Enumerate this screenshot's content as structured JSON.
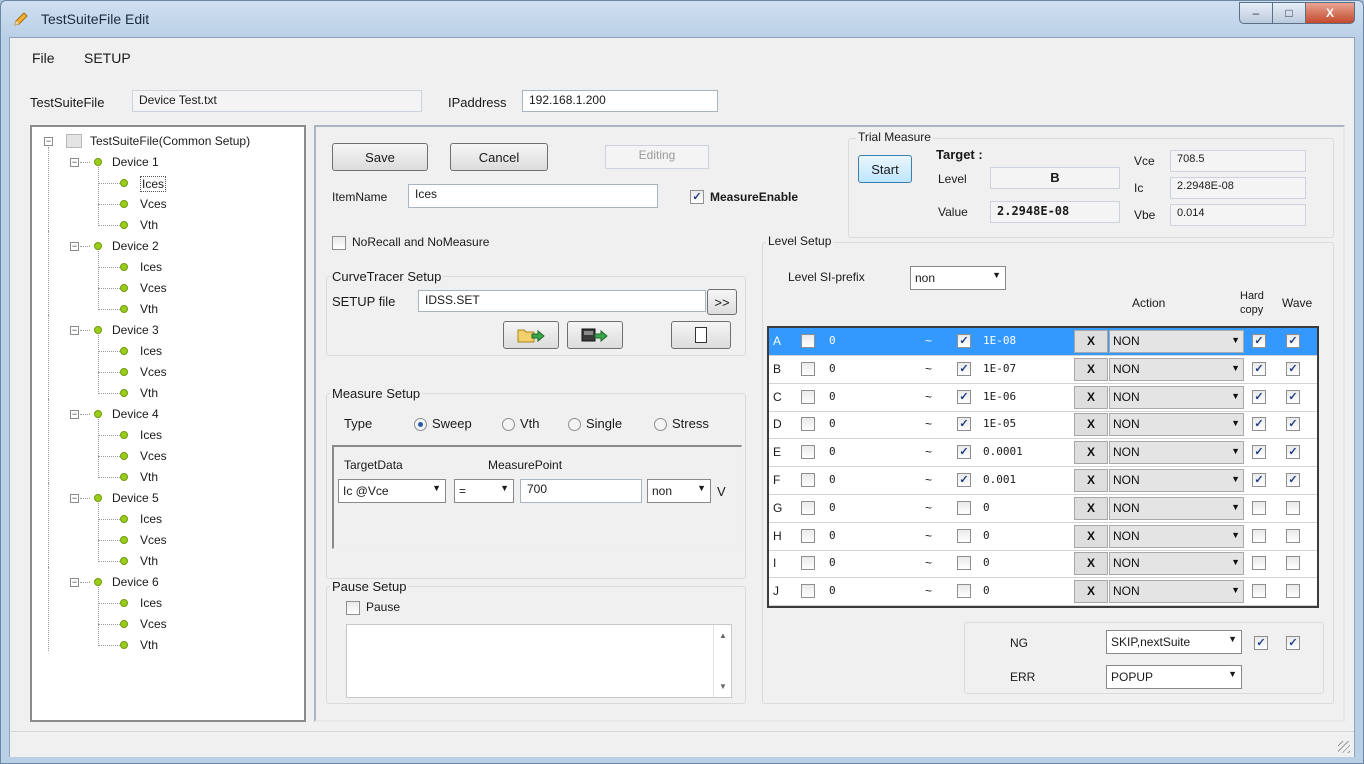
{
  "window": {
    "title": "TestSuiteFile Edit",
    "controls": {
      "min": "–",
      "max": "□",
      "close": "X"
    }
  },
  "menu": [
    "File",
    "SETUP"
  ],
  "header": {
    "file_label": "TestSuiteFile",
    "file_value": "Device Test.txt",
    "ip_label": "IPaddress",
    "ip_value": "192.168.1.200"
  },
  "tree": {
    "root": "TestSuiteFile(Common Setup)",
    "devices": [
      {
        "name": "Device 1",
        "items": [
          "Ices",
          "Vces",
          "Vth"
        ]
      },
      {
        "name": "Device 2",
        "items": [
          "Ices",
          "Vces",
          "Vth"
        ]
      },
      {
        "name": "Device 3",
        "items": [
          "Ices",
          "Vces",
          "Vth"
        ]
      },
      {
        "name": "Device 4",
        "items": [
          "Ices",
          "Vces",
          "Vth"
        ]
      },
      {
        "name": "Device 5",
        "items": [
          "Ices",
          "Vces",
          "Vth"
        ]
      },
      {
        "name": "Device 6",
        "items": [
          "Ices",
          "Vces",
          "Vth"
        ]
      }
    ]
  },
  "editor": {
    "save": "Save",
    "cancel": "Cancel",
    "status": "Editing",
    "item_name_label": "ItemName",
    "item_name_value": "Ices",
    "measure_enable": "MeasureEnable",
    "no_recall": "NoRecall and NoMeasure"
  },
  "curve_tracer": {
    "title": "CurveTracer Setup",
    "setup_file_label": "SETUP file",
    "setup_file_value": "IDSS.SET",
    "browse": ">>"
  },
  "measure_setup": {
    "title": "Measure Setup",
    "type_label": "Type",
    "types": [
      "Sweep",
      "Vth",
      "Single",
      "Stress"
    ],
    "selected_type": "Sweep",
    "target_label": "TargetData",
    "measure_point_label": "MeasurePoint",
    "target_value": "Ic @Vce",
    "compare_value": "=",
    "point_value": "700",
    "prefix_value": "non",
    "unit": "V"
  },
  "pause_setup": {
    "title": "Pause Setup",
    "pause_label": "Pause"
  },
  "trial": {
    "title": "Trial Measure",
    "start": "Start",
    "target_label": "Target :",
    "level_label": "Level",
    "level_value": "B",
    "value_label": "Value",
    "value_value": "2.2948E-08",
    "vce_label": "Vce",
    "vce_value": "708.5",
    "ic_label": "Ic",
    "ic_value": "2.2948E-08",
    "vbe_label": "Vbe",
    "vbe_value": "0.014"
  },
  "level_setup": {
    "title": "Level Setup",
    "si_prefix_label": "Level SI-prefix",
    "si_prefix_value": "non",
    "headers": {
      "action": "Action",
      "hard": "Hard",
      "copy": "copy",
      "wave": "Wave"
    },
    "tilde": "~",
    "x_label": "X",
    "rows": [
      {
        "level": "A",
        "low": "0",
        "high_checked": true,
        "high": "1E-08",
        "action": "NON",
        "hard": true,
        "wave": true
      },
      {
        "level": "B",
        "low": "0",
        "high_checked": true,
        "high": "1E-07",
        "action": "NON",
        "hard": true,
        "wave": true
      },
      {
        "level": "C",
        "low": "0",
        "high_checked": true,
        "high": "1E-06",
        "action": "NON",
        "hard": true,
        "wave": true
      },
      {
        "level": "D",
        "low": "0",
        "high_checked": true,
        "high": "1E-05",
        "action": "NON",
        "hard": true,
        "wave": true
      },
      {
        "level": "E",
        "low": "0",
        "high_checked": true,
        "high": "0.0001",
        "action": "NON",
        "hard": true,
        "wave": true
      },
      {
        "level": "F",
        "low": "0",
        "high_checked": true,
        "high": "0.001",
        "action": "NON",
        "hard": true,
        "wave": true
      },
      {
        "level": "G",
        "low": "0",
        "high_checked": false,
        "high": "0",
        "action": "NON",
        "hard": false,
        "wave": false
      },
      {
        "level": "H",
        "low": "0",
        "high_checked": false,
        "high": "0",
        "action": "NON",
        "hard": false,
        "wave": false
      },
      {
        "level": "I",
        "low": "0",
        "high_checked": false,
        "high": "0",
        "action": "NON",
        "hard": false,
        "wave": false
      },
      {
        "level": "J",
        "low": "0",
        "high_checked": false,
        "high": "0",
        "action": "NON",
        "hard": false,
        "wave": false
      }
    ],
    "ng_label": "NG",
    "ng_value": "SKIP,nextSuite",
    "err_label": "ERR",
    "err_value": "POPUP"
  },
  "colors": {
    "selection": "#3399ff",
    "led": "#9acd1a"
  }
}
